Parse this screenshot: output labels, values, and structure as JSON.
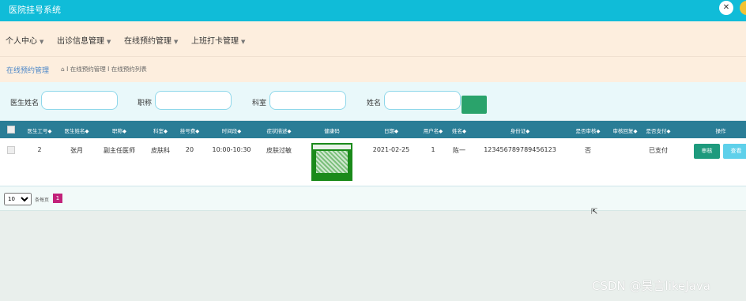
{
  "app": {
    "title": "医院挂号系统"
  },
  "menu": [
    {
      "label": "个人中心"
    },
    {
      "label": "出诊信息管理"
    },
    {
      "label": "在线预约管理"
    },
    {
      "label": "上班打卡管理"
    }
  ],
  "breadcrumb": {
    "title": "在线预约管理",
    "path": "I 在线预约管理 I 在线预约列表"
  },
  "search": {
    "labels": [
      "医生姓名",
      "职称",
      "科室",
      "姓名"
    ]
  },
  "table": {
    "headers": [
      "医生工号",
      "医生姓名",
      "职称",
      "科室",
      "挂号费",
      "时间段",
      "症状描述",
      "健康码",
      "日期",
      "用户名",
      "姓名",
      "身份证",
      "是否审核",
      "审核回复",
      "是否支付",
      "操作"
    ],
    "rows": [
      {
        "doctor_no": "2",
        "doctor_name": "张月",
        "title": "副主任医师",
        "dept": "皮肤科",
        "fee": "20",
        "time_slot": "10:00-10:30",
        "symptom": "皮肤过敏",
        "date": "2021-02-25",
        "username": "1",
        "name": "陈一",
        "id_card": "123456789789456123",
        "reviewed": "否",
        "reply": "",
        "paid": "已支付",
        "audit_label": "审核",
        "view_label": "查看"
      }
    ]
  },
  "pager": {
    "page_size": "10",
    "per_page_label": "条每页",
    "current_page": "1"
  },
  "watermark": "CSDN @昊言likeJava",
  "colors": {
    "topbar": "#10bcd8",
    "menubar": "#fdeede",
    "thead": "#2a7d96",
    "audit": "#1e9a7d",
    "view": "#5ed0ea",
    "page": "#c2227a"
  }
}
